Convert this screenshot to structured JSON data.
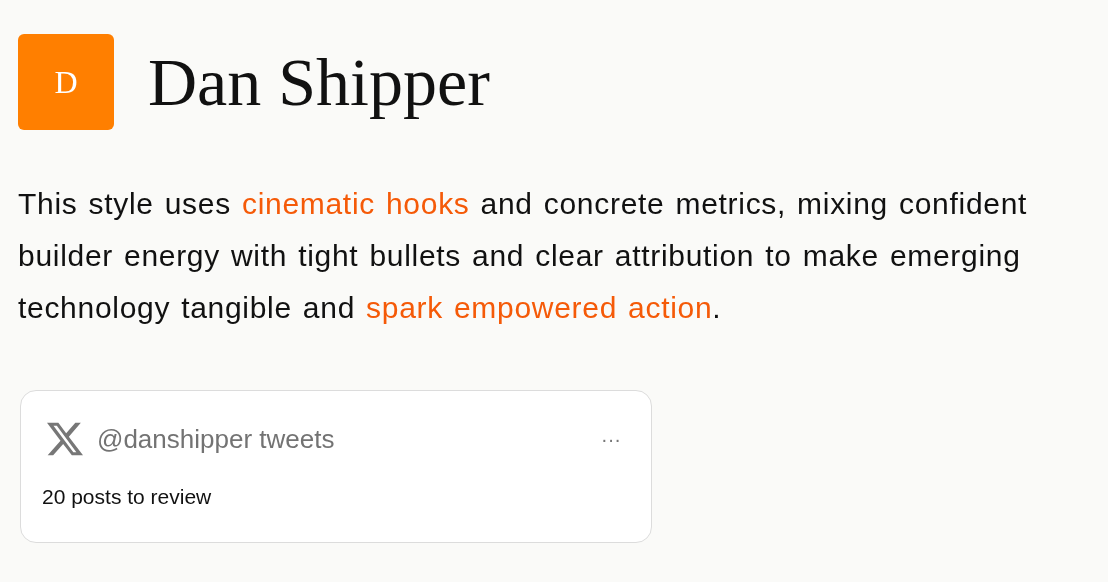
{
  "profile": {
    "initial": "D",
    "name": "Dan Shipper"
  },
  "description": [
    {
      "text": "This style uses ",
      "highlight": false
    },
    {
      "text": "cinematic hooks",
      "highlight": true
    },
    {
      "text": " and concrete metrics, mixing confident builder energy with tight bullets and clear attribution to make emerging technology tangible and ",
      "highlight": false
    },
    {
      "text": "spark empowered action",
      "highlight": true
    },
    {
      "text": ".",
      "highlight": false
    }
  ],
  "source_card": {
    "title": "@danshipper tweets",
    "menu": "···",
    "subtitle": "20 posts to review"
  }
}
